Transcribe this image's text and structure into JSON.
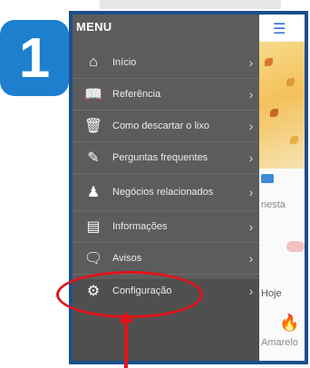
{
  "step": {
    "number": "1"
  },
  "drawer": {
    "title": "MENU",
    "items": [
      {
        "label": "Início",
        "icon": "home-icon"
      },
      {
        "label": "Referência",
        "icon": "book-icon"
      },
      {
        "label": "Como descartar o lixo",
        "icon": "trash-icon"
      },
      {
        "label": "Perguntas frequentes",
        "icon": "edit-icon"
      },
      {
        "label": "Negócios relacionados",
        "icon": "person-icon"
      },
      {
        "label": "Informações",
        "icon": "info-icon"
      },
      {
        "label": "Avisos",
        "icon": "message-icon"
      },
      {
        "label": "Configuração",
        "icon": "gear-icon"
      }
    ]
  },
  "background": {
    "text_nesta": "nesta",
    "text_hoje": "Hoje",
    "text_amarelo": "Amarelo"
  },
  "colors": {
    "accent": "#1e7fcf",
    "drawer_bg": "#5c5c5c",
    "annotation": "#e0141b"
  }
}
